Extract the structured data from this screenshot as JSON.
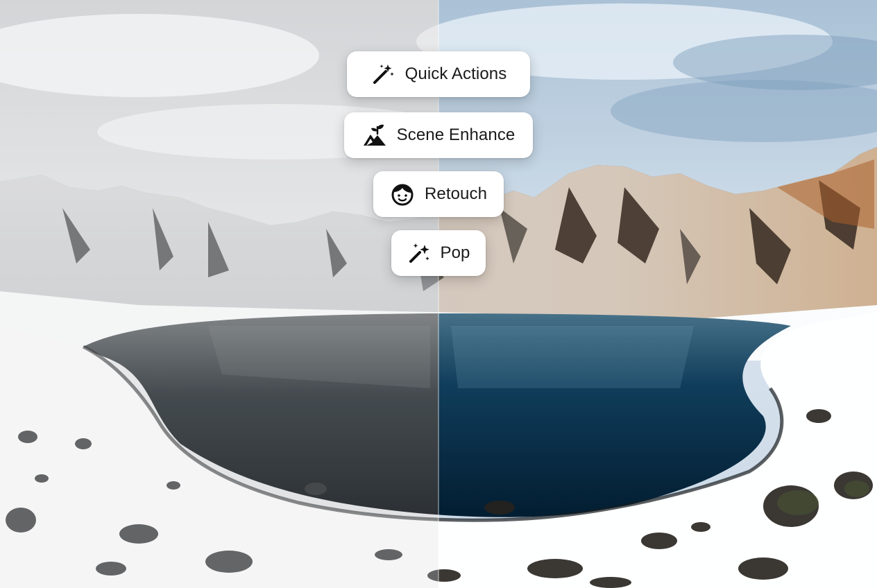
{
  "comparison": {
    "before_label": "",
    "after_label": ""
  },
  "actions": [
    {
      "label": "Quick Actions",
      "icon": "magic-wand-icon"
    },
    {
      "label": "Scene Enhance",
      "icon": "landscape-sprout-icon"
    },
    {
      "label": "Retouch",
      "icon": "face-icon"
    },
    {
      "label": "Pop",
      "icon": "sparkle-wand-icon"
    }
  ],
  "colors": {
    "chip_background": "#ffffff",
    "chip_text": "#1a1a1a",
    "water_after": "#173447",
    "water_before": "#3b4a55"
  }
}
